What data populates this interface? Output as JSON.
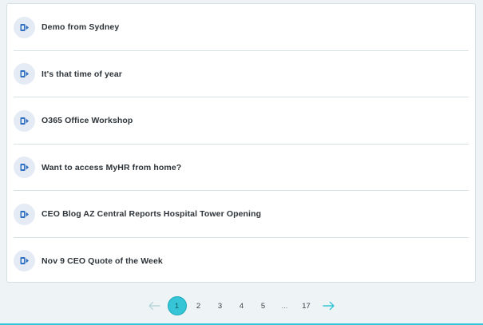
{
  "news_list": {
    "items": [
      {
        "title": "Demo from Sydney",
        "icon": "document-icon"
      },
      {
        "title": "It's that time of year",
        "icon": "document-icon"
      },
      {
        "title": "O365 Office Workshop",
        "icon": "document-icon"
      },
      {
        "title": "Want to access MyHR from home?",
        "icon": "document-icon"
      },
      {
        "title": "CEO Blog AZ Central Reports Hospital Tower Opening",
        "icon": "document-icon"
      },
      {
        "title": "Nov 9 CEO Quote of the Week",
        "icon": "document-icon"
      }
    ]
  },
  "pagination": {
    "prev_icon": "arrow-left-icon",
    "next_icon": "arrow-right-icon",
    "pages": [
      "1",
      "2",
      "3",
      "4",
      "5",
      "...",
      "17"
    ],
    "current": "1"
  },
  "colors": {
    "accent": "#35c5d7",
    "icon_blue": "#2f6fc1",
    "icon_badge_bg": "#e5ebf4",
    "arrow_prev_disabled": "#b8d6dc",
    "arrow_next": "#35c5d7"
  }
}
